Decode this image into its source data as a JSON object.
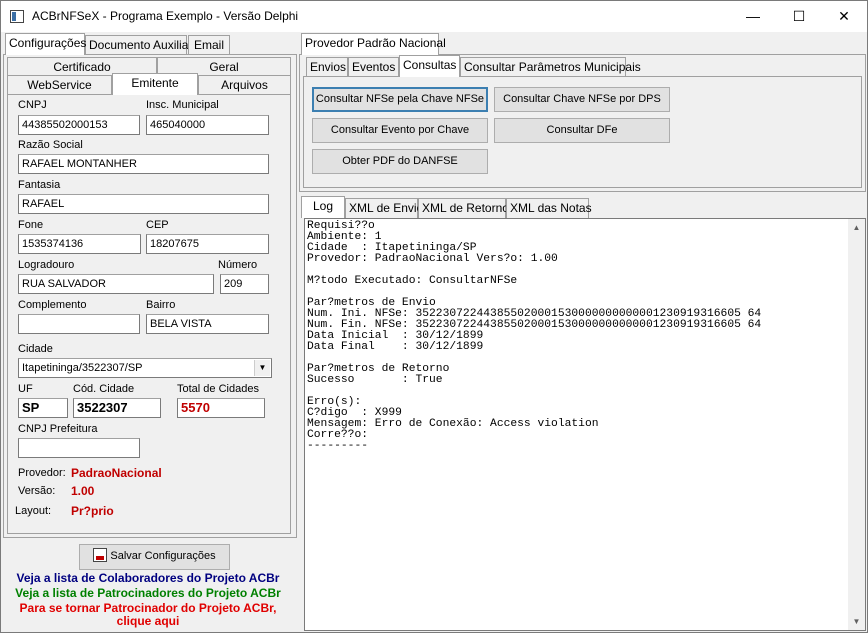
{
  "window": {
    "title": "ACBrNFSeX - Programa Exemplo - Versão Delphi",
    "minimize": "—",
    "maximize": "☐",
    "close": "✕"
  },
  "left": {
    "top_tabs": [
      "Configurações",
      "Documento Auxiliar",
      "Email"
    ],
    "sub_tabs_row1": [
      "Certificado",
      "Geral"
    ],
    "sub_tabs_row2": [
      "WebService",
      "Emitente",
      "Arquivos"
    ],
    "form": {
      "cnpj_label": "CNPJ",
      "cnpj": "44385502000153",
      "insc_label": "Insc. Municipal",
      "insc": "465040000",
      "razao_label": "Razão Social",
      "razao": "RAFAEL MONTANHER",
      "fantasia_label": "Fantasia",
      "fantasia": "RAFAEL",
      "fone_label": "Fone",
      "fone": "1535374136",
      "cep_label": "CEP",
      "cep": "18207675",
      "logradouro_label": "Logradouro",
      "logradouro": "RUA SALVADOR",
      "numero_label": "Número",
      "numero": "209",
      "complemento_label": "Complemento",
      "complemento": "",
      "bairro_label": "Bairro",
      "bairro": "BELA VISTA",
      "cidade_label": "Cidade",
      "cidade": "Itapetininga/3522307/SP",
      "uf_label": "UF",
      "uf": "SP",
      "cod_cidade_label": "Cód. Cidade",
      "cod_cidade": "3522307",
      "total_cidades_label": "Total de Cidades",
      "total_cidades": "5570",
      "cnpj_pref_label": "CNPJ Prefeitura",
      "cnpj_pref": ""
    },
    "info": {
      "provedor_label": "Provedor:",
      "provedor": "PadraoNacional",
      "versao_label": "Versão:",
      "versao": "1.00",
      "layout_label": "Layout:",
      "layout": "Pr?prio"
    },
    "save_button": "Salvar Configurações",
    "links": {
      "colaboradores": "Veja a lista de Colaboradores do Projeto ACBr",
      "patrocinadores": "Veja a lista de Patrocinadores do Projeto ACBr",
      "tornar1": "Para se tornar Patrocinador do Projeto ACBr,",
      "tornar2": "clique aqui"
    }
  },
  "right": {
    "provider_tab": "Provedor Padrão Nacional",
    "action_tabs": [
      "Envios",
      "Eventos",
      "Consultas",
      "Consultar Parâmetros Municipais"
    ],
    "buttons": {
      "consultar_chave": "Consultar NFSe pela Chave NFSe",
      "consultar_dps": "Consultar Chave NFSe por DPS",
      "consultar_evento": "Consultar Evento por Chave",
      "consultar_dfe": "Consultar DFe",
      "obter_pdf": "Obter PDF do DANFSE"
    },
    "log_tabs": [
      "Log",
      "XML de Envio",
      "XML de Retorno",
      "XML das Notas"
    ],
    "log_text": "Requisi??o\nAmbiente: 1\nCidade  : Itapetininga/SP\nProvedor: PadraoNacional Vers?o: 1.00\n\nM?todo Executado: ConsultarNFSe\n\nPar?metros de Envio\nNum. Ini. NFSe: 352230722443855020001530000000000001230919316605 64\nNum. Fin. NFSe: 352230722443855020001530000000000001230919316605 64\nData Inicial  : 30/12/1899\nData Final    : 30/12/1899\n\nPar?metros de Retorno\nSucesso       : True\n\nErro(s):\nC?digo  : X999\nMensagem: Erro de Conexão: Access violation\nCorre??o:\n---------"
  },
  "colors": {
    "red": "#c00000",
    "navy": "#000080",
    "green": "#008000"
  }
}
